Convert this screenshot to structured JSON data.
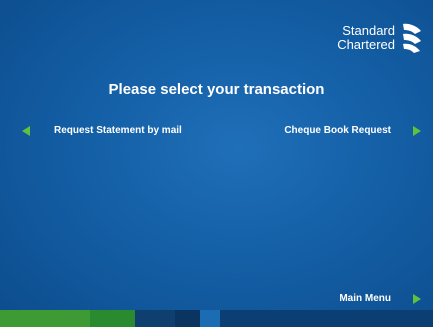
{
  "brand": {
    "line1": "Standard",
    "line2": "Chartered"
  },
  "screen": {
    "title": "Please select your transaction"
  },
  "options": {
    "left_1": "Request Statement by mail",
    "right_1": "Cheque Book Request",
    "bottom_right": "Main Menu"
  },
  "icons": {
    "arrow": "green-triangle-arrow-icon",
    "logo": "standard-chartered-logo"
  },
  "colors": {
    "background": "#145fa6",
    "arrow": "#5fc23c",
    "footer": [
      "#3d9a35",
      "#2a8a2f",
      "#0e3f6e",
      "#0a3560",
      "#1c6cb4",
      "#0b3f73"
    ]
  }
}
